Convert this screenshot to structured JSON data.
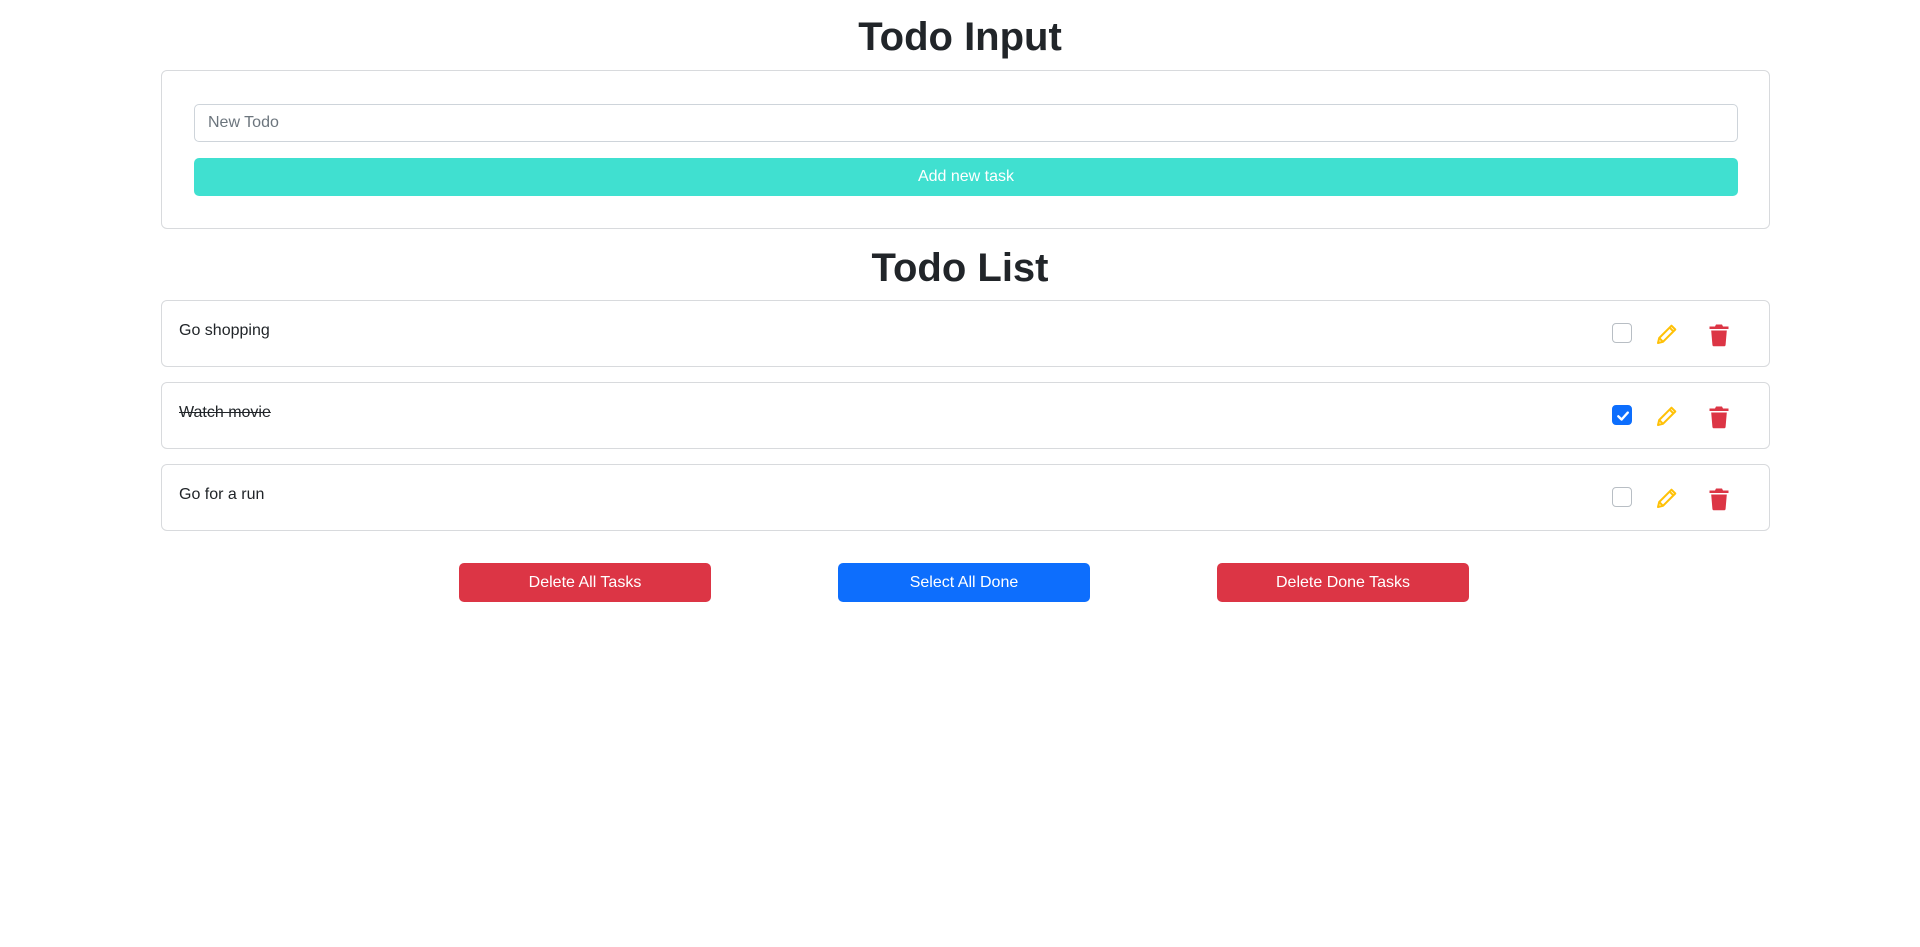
{
  "input_section": {
    "title": "Todo Input",
    "input_placeholder": "New Todo",
    "input_value": "",
    "add_button_label": "Add new task"
  },
  "list_section": {
    "title": "Todo List",
    "items": [
      {
        "text": "Go shopping",
        "done": false
      },
      {
        "text": "Watch movie",
        "done": true
      },
      {
        "text": "Go for a run",
        "done": false
      }
    ]
  },
  "actions": {
    "delete_all_label": "Delete All Tasks",
    "select_all_done_label": "Select All Done",
    "delete_done_label": "Delete Done Tasks"
  },
  "colors": {
    "accent_teal": "#40e0d0",
    "primary_blue": "#0d6efd",
    "danger_red": "#dc3545",
    "edit_yellow": "#ffc107"
  },
  "icons": {
    "edit": "pencil-icon",
    "delete": "trash-icon",
    "check": "checkmark-icon"
  }
}
